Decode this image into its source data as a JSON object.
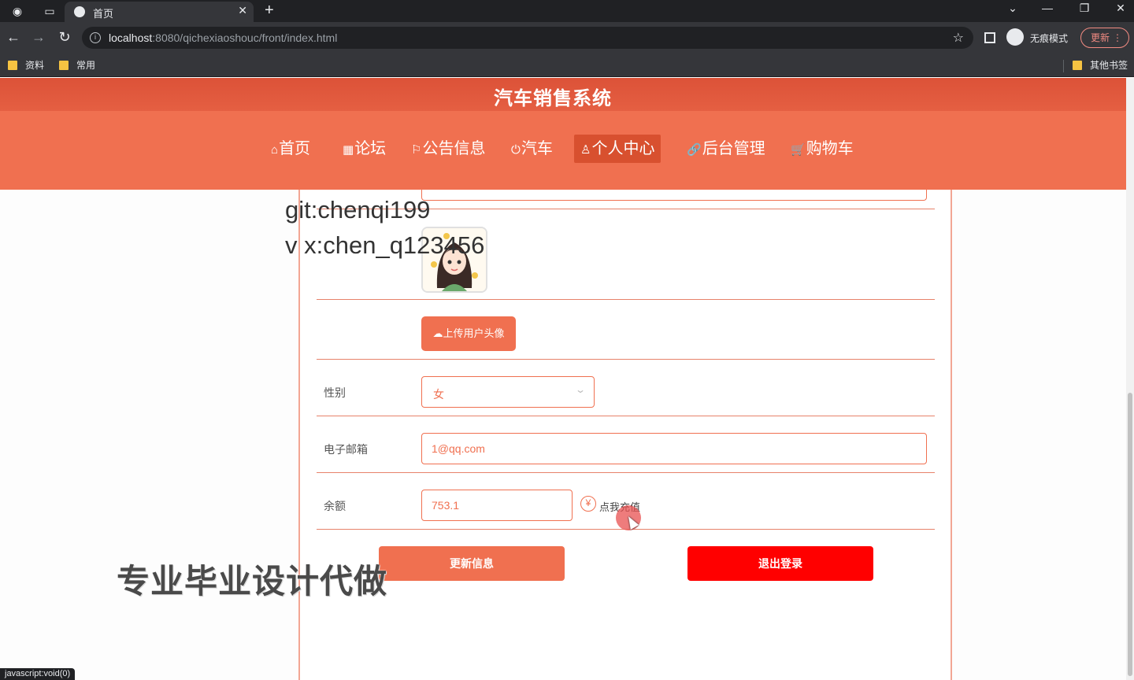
{
  "browser": {
    "tab_title": "首页",
    "url_host": "localhost",
    "url_rest": ":8080/qichexiaoshouc/front/index.html",
    "incognito_label": "无痕模式",
    "update_label": "更新",
    "bookmarks": [
      "资料",
      "常用"
    ],
    "other_bookmarks": "其他书签",
    "status_url": "javascript:void(0)"
  },
  "site": {
    "title": "汽车销售系统",
    "nav": [
      {
        "label": "首页",
        "icon": "home-icon",
        "glyph": "⌂"
      },
      {
        "label": "论坛",
        "icon": "grid-icon",
        "glyph": "▦"
      },
      {
        "label": "公告信息",
        "icon": "flag-icon",
        "glyph": "⚐"
      },
      {
        "label": "汽车",
        "icon": "power-icon",
        "glyph": "⏻"
      },
      {
        "label": "个人中心",
        "icon": "user-icon",
        "glyph": "♙"
      },
      {
        "label": "后台管理",
        "icon": "link-icon",
        "glyph": "🔗"
      },
      {
        "label": "购物车",
        "icon": "cart-icon",
        "glyph": "🛒"
      }
    ],
    "active_nav": "个人中心"
  },
  "form": {
    "upload_label": "上传用户头像",
    "gender_label": "性别",
    "gender_value": "女",
    "email_label": "电子邮箱",
    "email_value": "1@qq.com",
    "balance_label": "余额",
    "balance_value": "753.1",
    "recharge_label": "点我充值",
    "update_button": "更新信息",
    "logout_button": "退出登录"
  },
  "overlay": {
    "watermark_line1": "git:chenqi199",
    "watermark_line2": "v x:chen_q123456",
    "promo_text": "专业毕业设计代做"
  },
  "colors": {
    "brand": "#f07050",
    "logout": "#ff0000"
  }
}
